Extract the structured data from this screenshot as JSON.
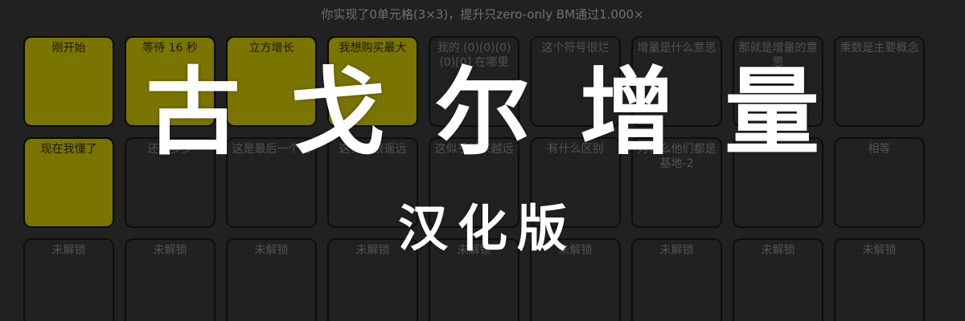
{
  "status_text": "你实现了0单元格(3×3)，提升只zero-only BM通过1.000×",
  "overlay": {
    "title": "古戈尔增量",
    "subtitle": "汉化版"
  },
  "colors": {
    "background": "#212121",
    "completed_cell": "#7a7400",
    "locked_text": "#525252",
    "overlay_text": "#ffffff"
  },
  "rows": [
    {
      "cells": [
        {
          "label": "刚开始",
          "completed": true
        },
        {
          "label": "等待 16 秒",
          "completed": true
        },
        {
          "label": "立方增长",
          "completed": true
        },
        {
          "label": "我想购买最大",
          "completed": true
        },
        {
          "label": "我的 (0)(0)(0)(0)[0] 在哪里",
          "completed": false
        },
        {
          "label": "这个符号很烂",
          "completed": false
        },
        {
          "label": "增量是什么意思",
          "completed": false
        },
        {
          "label": "那就是增量的意思",
          "completed": false
        },
        {
          "label": "乘数是主要概念",
          "completed": false
        }
      ]
    },
    {
      "cells": [
        {
          "label": "现在我懂了",
          "completed": true
        },
        {
          "label": "还差多少",
          "completed": false
        },
        {
          "label": "这是最后一个吗",
          "completed": false
        },
        {
          "label": "这似乎很遥远",
          "completed": false
        },
        {
          "label": "这似乎越来越远",
          "completed": false
        },
        {
          "label": "有什么区别",
          "completed": false
        },
        {
          "label": "为什么他们都是基地-2",
          "completed": false
        },
        {
          "label": "",
          "completed": false
        },
        {
          "label": "相等",
          "completed": false
        }
      ]
    },
    {
      "cells": [
        {
          "label": "未解锁",
          "completed": false
        },
        {
          "label": "未解锁",
          "completed": false
        },
        {
          "label": "未解锁",
          "completed": false
        },
        {
          "label": "未解锁",
          "completed": false
        },
        {
          "label": "未解锁",
          "completed": false
        },
        {
          "label": "未解锁",
          "completed": false
        },
        {
          "label": "未解锁",
          "completed": false
        },
        {
          "label": "未解锁",
          "completed": false
        },
        {
          "label": "未解锁",
          "completed": false
        }
      ]
    }
  ]
}
